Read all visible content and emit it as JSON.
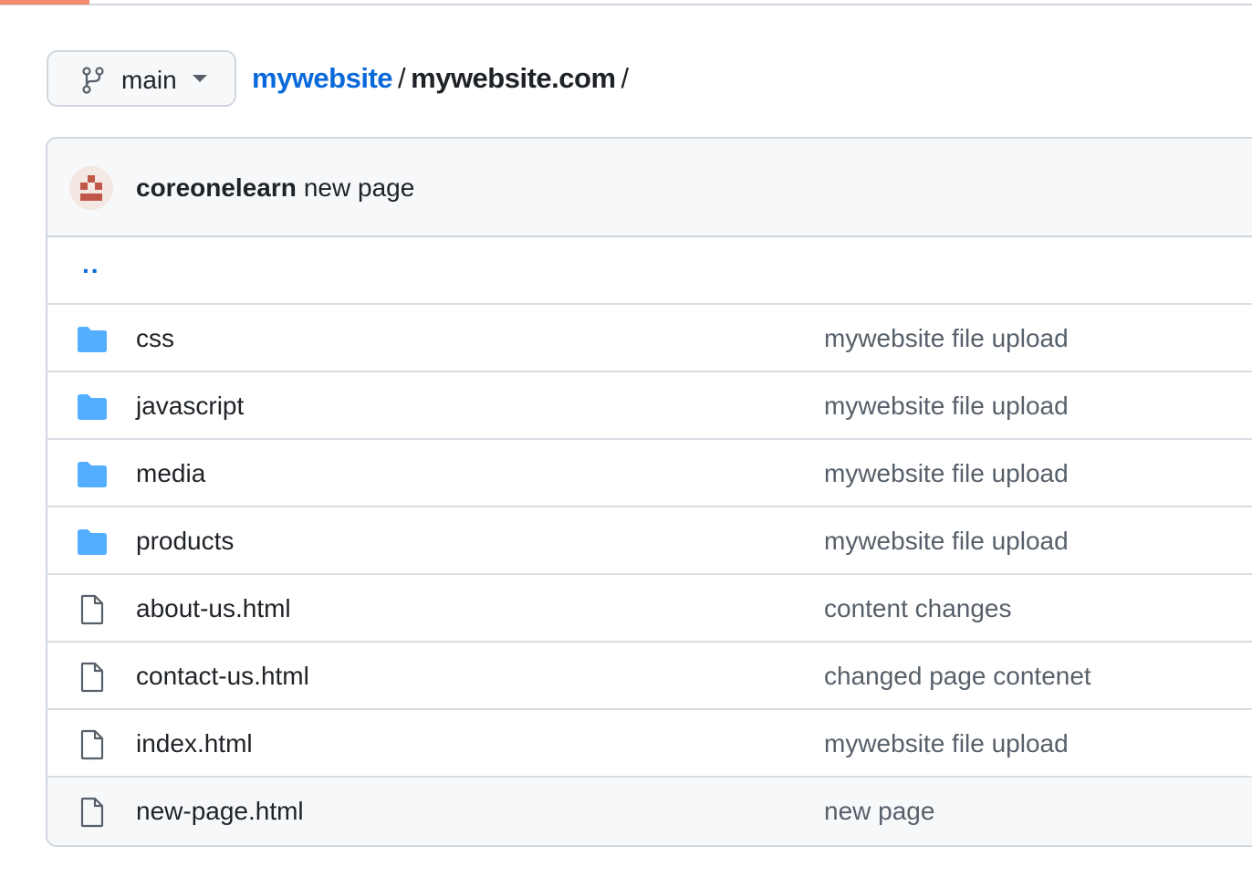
{
  "branch": {
    "name": "main",
    "icon": "git-branch-icon",
    "menu_icon": "caret-down-icon"
  },
  "breadcrumb": {
    "repo": "mywebsite",
    "separator": "/",
    "folder": "mywebsite.com",
    "trailing": "/"
  },
  "latest_commit": {
    "author": "coreonelearn",
    "message": "new page",
    "avatar_icon": "identicon-avatar"
  },
  "parent_link": "..",
  "files": [
    {
      "type": "folder",
      "icon": "folder-icon",
      "name": "css",
      "commit": "mywebsite file upload"
    },
    {
      "type": "folder",
      "icon": "folder-icon",
      "name": "javascript",
      "commit": "mywebsite file upload"
    },
    {
      "type": "folder",
      "icon": "folder-icon",
      "name": "media",
      "commit": "mywebsite file upload"
    },
    {
      "type": "folder",
      "icon": "folder-icon",
      "name": "products",
      "commit": "mywebsite file upload"
    },
    {
      "type": "file",
      "icon": "file-icon",
      "name": "about-us.html",
      "commit": "content changes"
    },
    {
      "type": "file",
      "icon": "file-icon",
      "name": "contact-us.html",
      "commit": "changed page contenet"
    },
    {
      "type": "file",
      "icon": "file-icon",
      "name": "index.html",
      "commit": "mywebsite file upload"
    },
    {
      "type": "file",
      "icon": "file-icon",
      "name": "new-page.html",
      "commit": "new page"
    }
  ],
  "colors": {
    "link": "#0969da",
    "folder": "#54aeff",
    "muted_text": "#57606a",
    "border": "#d0d7de",
    "header_bg": "#f6f8fa",
    "progress_bar": "#f28b6b",
    "avatar": "#c0584a"
  }
}
